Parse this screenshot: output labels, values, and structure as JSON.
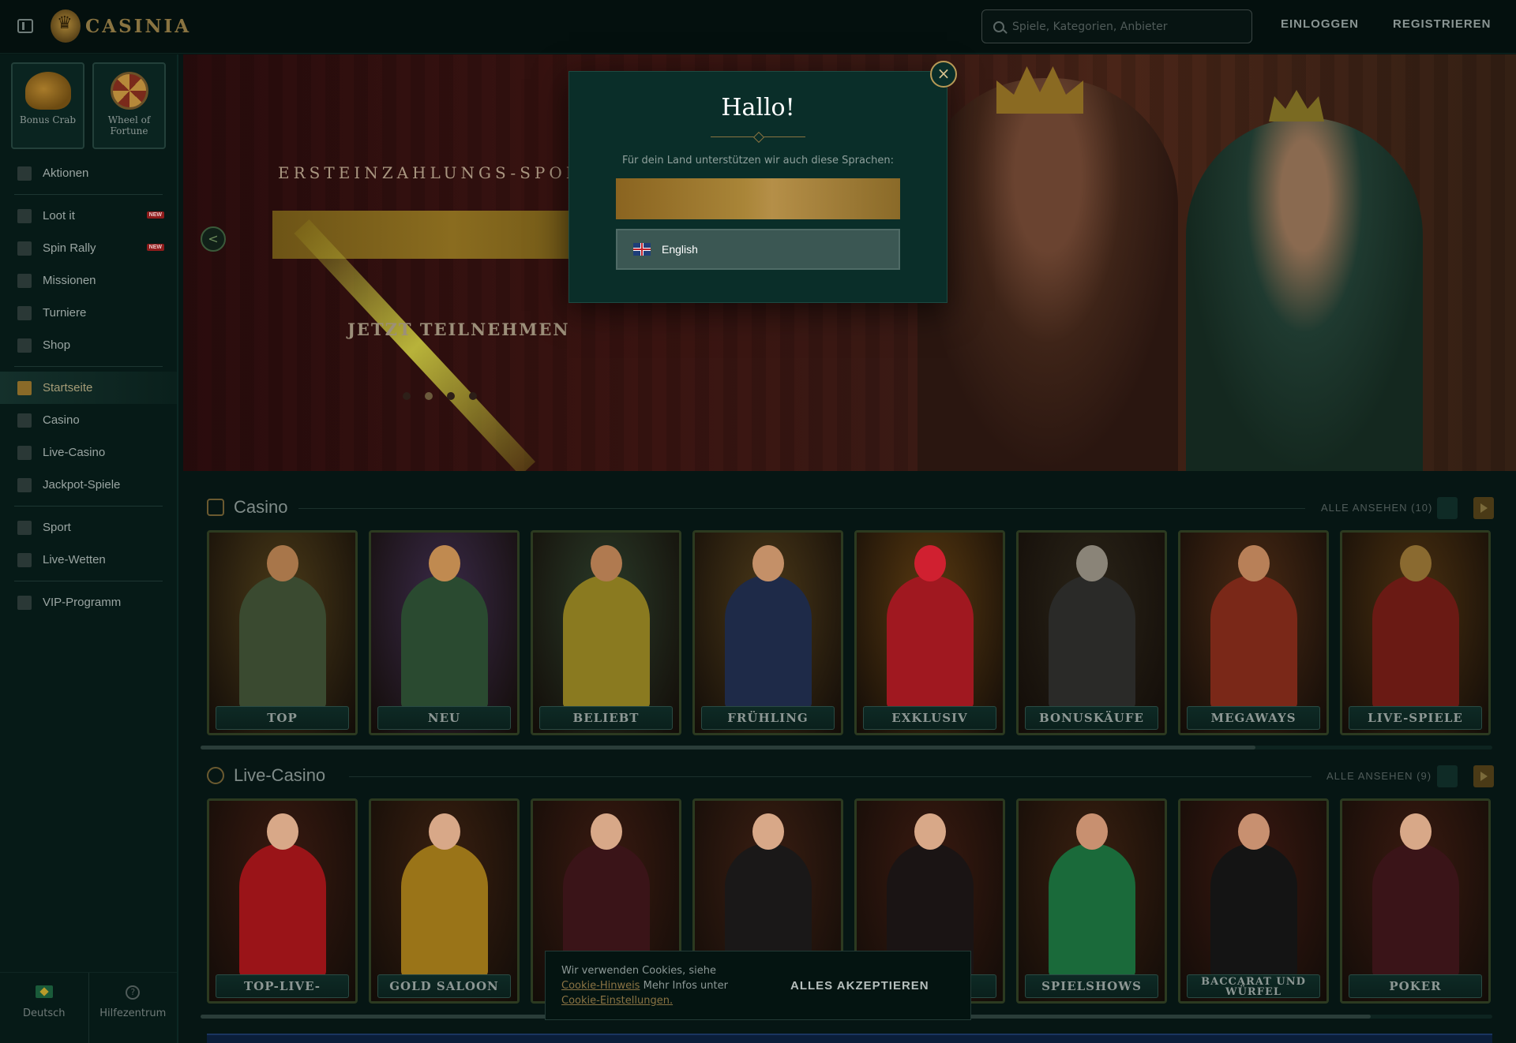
{
  "header": {
    "logo_text": "CASINIA",
    "search_placeholder": "Spiele, Kategorien, Anbieter",
    "login_label": "EINLOGGEN",
    "register_label": "REGISTRIEREN"
  },
  "sidebar": {
    "promos": [
      {
        "label": "Bonus Crab",
        "icon": "crab-icon"
      },
      {
        "label": "Wheel of Fortune",
        "icon": "wheel-icon"
      }
    ],
    "groups": [
      [
        {
          "label": "Aktionen"
        }
      ],
      [
        {
          "label": "Loot it",
          "badge": "NEW"
        },
        {
          "label": "Spin Rally",
          "badge": "NEW"
        },
        {
          "label": "Missionen"
        },
        {
          "label": "Turniere"
        },
        {
          "label": "Shop"
        }
      ],
      [
        {
          "label": "Startseite",
          "active": true
        },
        {
          "label": "Casino"
        },
        {
          "label": "Live-Casino"
        },
        {
          "label": "Jackpot-Spiele"
        }
      ],
      [
        {
          "label": "Sport"
        },
        {
          "label": "Live-Wetten"
        }
      ],
      [
        {
          "label": "VIP-Programm"
        }
      ]
    ],
    "footer": {
      "language_label": "Deutsch",
      "help_label": "Hilfezentrum"
    }
  },
  "hero": {
    "title": "ERSTEINZAHLUNGS-SPORTBONUS",
    "cta_label": "JETZT TEILNEHMEN",
    "slides_count": 4,
    "active_slide": 2
  },
  "casino": {
    "title": "Casino",
    "see_all_label": "ALLE ANSEHEN (10)",
    "cards": [
      {
        "label": "TOP",
        "bg": "#4a3a18",
        "fig": "#3a4a30",
        "skin": "#a8764a"
      },
      {
        "label": "NEU",
        "bg": "#3a2a48",
        "fig": "#2a4a30",
        "skin": "#c08a50"
      },
      {
        "label": "BELIEBT",
        "bg": "#2a3a28",
        "fig": "#8a7a20",
        "skin": "#b07a50"
      },
      {
        "label": "FRÜHLING",
        "bg": "#4a3818",
        "fig": "#1e2a48",
        "skin": "#c49068"
      },
      {
        "label": "EXKLUSIV",
        "bg": "#5a3a10",
        "fig": "#a01820",
        "skin": "#d02030"
      },
      {
        "label": "BONUSKÄUFE",
        "bg": "#2a2418",
        "fig": "#2a2a28",
        "skin": "#8a8478"
      },
      {
        "label": "MEGAWAYS",
        "bg": "#4a2a14",
        "fig": "#7a2818",
        "skin": "#b88058"
      },
      {
        "label": "LIVE-SPIELE",
        "bg": "#4a3010",
        "fig": "#6a1a14",
        "skin": "#8a6a30"
      }
    ]
  },
  "live_casino": {
    "title": "Live-Casino",
    "see_all_label": "ALLE ANSEHEN (9)",
    "cards": [
      {
        "label": "TOP-LIVE-CASINO",
        "bg": "#3a1a10",
        "fig": "#9a1418",
        "skin": "#d8a888"
      },
      {
        "label": "GOLD SALOON",
        "bg": "#3a2010",
        "fig": "#9a7418",
        "skin": "#d8a888"
      },
      {
        "label": "",
        "bg": "#3a1a10",
        "fig": "#3a1418",
        "skin": "#d8a888"
      },
      {
        "label": "",
        "bg": "#3a1e12",
        "fig": "#1a1818",
        "skin": "#d8a888"
      },
      {
        "label": "LE",
        "bg": "#3a1a10",
        "fig": "#1a1414",
        "skin": "#d8a888"
      },
      {
        "label": "SPIELSHOWS",
        "bg": "#3a2010",
        "fig": "#1a6a3a",
        "skin": "#c89070"
      },
      {
        "label": "BACCARAT UND WÜRFEL",
        "bg": "#3a1810",
        "fig": "#141414",
        "skin": "#c89070"
      },
      {
        "label": "POKER",
        "bg": "#3a1a10",
        "fig": "#3a1418",
        "skin": "#d8a888"
      }
    ]
  },
  "modal": {
    "title": "Hallo!",
    "subtitle": "Für dein Land unterstützen wir auch diese Sprachen:",
    "language_option": "English"
  },
  "cookie": {
    "text_start": "Wir verwenden Cookies, siehe",
    "link1": "Cookie-Hinweis",
    "text_mid": "Mehr Infos unter",
    "link2": "Cookie-Einstellungen.",
    "accept_label": "ALLES AKZEPTIEREN"
  }
}
